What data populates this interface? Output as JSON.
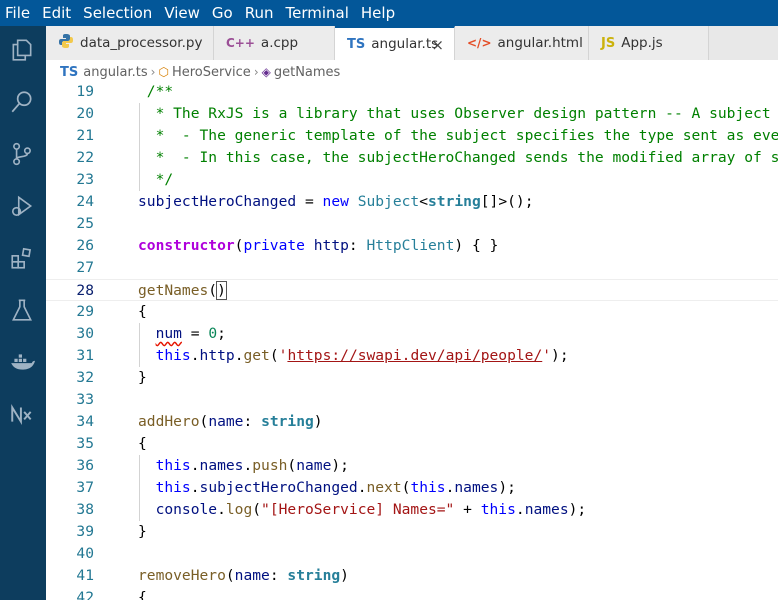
{
  "menu": [
    "File",
    "Edit",
    "Selection",
    "View",
    "Go",
    "Run",
    "Terminal",
    "Help"
  ],
  "tabs": [
    {
      "label": "data_processor.py",
      "icon": "python-icon",
      "badge": ""
    },
    {
      "label": "a.cpp",
      "icon": "cpp-icon",
      "badge": "C++"
    },
    {
      "label": "angular.ts",
      "icon": "typescript-icon",
      "badge": "TS",
      "active": true
    },
    {
      "label": "angular.html",
      "icon": "html-icon",
      "badge": "</>"
    },
    {
      "label": "App.js",
      "icon": "javascript-icon",
      "badge": "JS"
    }
  ],
  "breadcrumb": {
    "file_badge": "TS",
    "file": "angular.ts",
    "class": "HeroService",
    "method": "getNames"
  },
  "editor": {
    "current_line": 28,
    "lines": [
      {
        "n": "19",
        "text": " /**"
      },
      {
        "n": "20",
        "text": "  * The RxJS is a library that uses Observer design pattern -- A subject e"
      },
      {
        "n": "21",
        "text": "  *  - The generic template of the subject specifies the type sent as even"
      },
      {
        "n": "22",
        "text": "  *  - In this case, the subjectHeroChanged sends the modified array of st"
      },
      {
        "n": "23",
        "text": "  */"
      },
      {
        "n": "24",
        "text": "subjectHeroChanged = new Subject<string[]>();"
      },
      {
        "n": "25",
        "text": ""
      },
      {
        "n": "26",
        "text": "constructor(private http: HttpClient) { }"
      },
      {
        "n": "27",
        "text": ""
      },
      {
        "n": "28",
        "text": "getNames()"
      },
      {
        "n": "29",
        "text": "{"
      },
      {
        "n": "30",
        "text": "  num = 0;"
      },
      {
        "n": "31",
        "text": "  this.http.get('https://swapi.dev/api/people/');"
      },
      {
        "n": "32",
        "text": "}"
      },
      {
        "n": "33",
        "text": ""
      },
      {
        "n": "34",
        "text": "addHero(name: string)"
      },
      {
        "n": "35",
        "text": "{"
      },
      {
        "n": "36",
        "text": "  this.names.push(name);"
      },
      {
        "n": "37",
        "text": "  this.subjectHeroChanged.next(this.names);"
      },
      {
        "n": "38",
        "text": "  console.log(\"[HeroService] Names=\" + this.names);"
      },
      {
        "n": "39",
        "text": "}"
      },
      {
        "n": "40",
        "text": ""
      },
      {
        "n": "41",
        "text": "removeHero(name: string)"
      },
      {
        "n": "42",
        "text": "{"
      }
    ]
  },
  "colors": {
    "menubar": "#035799",
    "activitybar": "#0d3d5e",
    "comment": "#008000",
    "keyword": "#0000ff",
    "function": "#795e26",
    "string": "#a31515",
    "number": "#098658"
  },
  "activity_icons": [
    "explorer-icon",
    "search-icon",
    "source-control-icon",
    "run-debug-icon",
    "extensions-icon",
    "testing-flask-icon",
    "docker-icon",
    "nx-console-icon"
  ]
}
